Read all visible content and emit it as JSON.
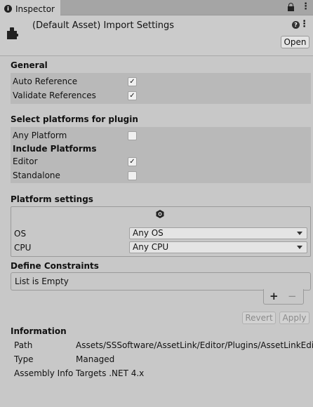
{
  "tab": {
    "title": "Inspector"
  },
  "header": {
    "title": "(Default Asset) Import Settings",
    "open_label": "Open"
  },
  "general": {
    "title": "General",
    "rows": [
      {
        "label": "Auto Reference",
        "checked": true
      },
      {
        "label": "Validate References",
        "checked": true
      }
    ]
  },
  "platforms": {
    "title": "Select platforms for plugin",
    "any_platform": {
      "label": "Any Platform",
      "checked": false
    },
    "include_title": "Include Platforms",
    "rows": [
      {
        "label": "Editor",
        "checked": true
      },
      {
        "label": "Standalone",
        "checked": false
      }
    ]
  },
  "platform_settings": {
    "title": "Platform settings",
    "os": {
      "label": "OS",
      "value": "Any OS"
    },
    "cpu": {
      "label": "CPU",
      "value": "Any CPU"
    }
  },
  "define_constraints": {
    "title": "Define Constraints",
    "empty_text": "List is Empty",
    "add_symbol": "+",
    "remove_symbol": "−"
  },
  "actions": {
    "revert_label": "Revert",
    "apply_label": "Apply"
  },
  "information": {
    "title": "Information",
    "rows": [
      {
        "label": "Path",
        "value": "Assets/SSSoftware/AssetLink/Editor/Plugins/AssetLinkEdit"
      },
      {
        "label": "Type",
        "value": "Managed"
      },
      {
        "label": "Assembly Info",
        "value": "Targets .NET 4.x"
      }
    ]
  }
}
